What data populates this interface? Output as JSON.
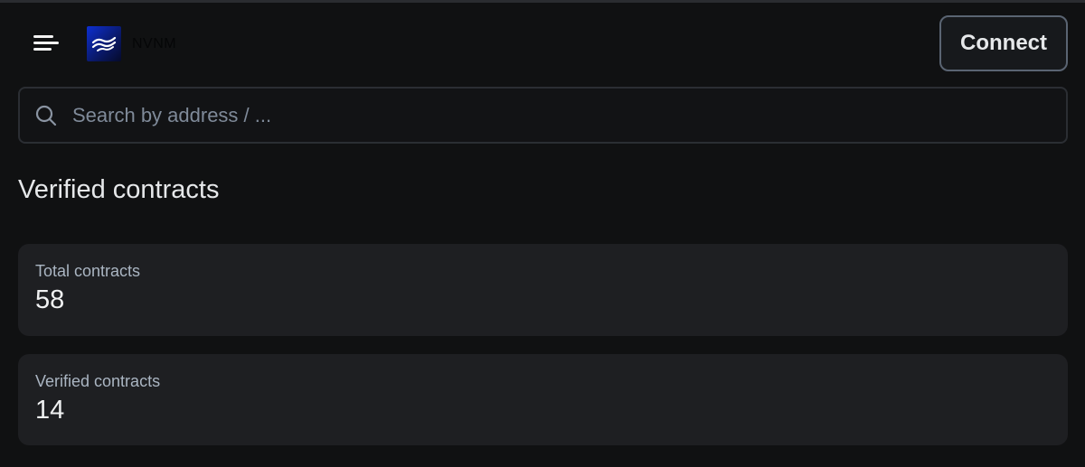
{
  "header": {
    "menu_icon": "hamburger-menu-icon",
    "logo": {
      "text": "NVNM",
      "icon": "waves-logo-icon",
      "colors": {
        "from": "#0d2fd1",
        "to": "#050a2a"
      }
    },
    "connect_label": "Connect"
  },
  "search": {
    "icon": "search-icon",
    "placeholder": "Search by address / ...",
    "value": ""
  },
  "main": {
    "title": "Verified contracts",
    "stats": [
      {
        "label": "Total contracts",
        "value": "58"
      },
      {
        "label": "Verified contracts",
        "value": "14"
      }
    ]
  },
  "colors": {
    "background": "#101112",
    "card": "#1e1f22",
    "border": "#5a6472",
    "muted_text": "#aab5c2"
  }
}
